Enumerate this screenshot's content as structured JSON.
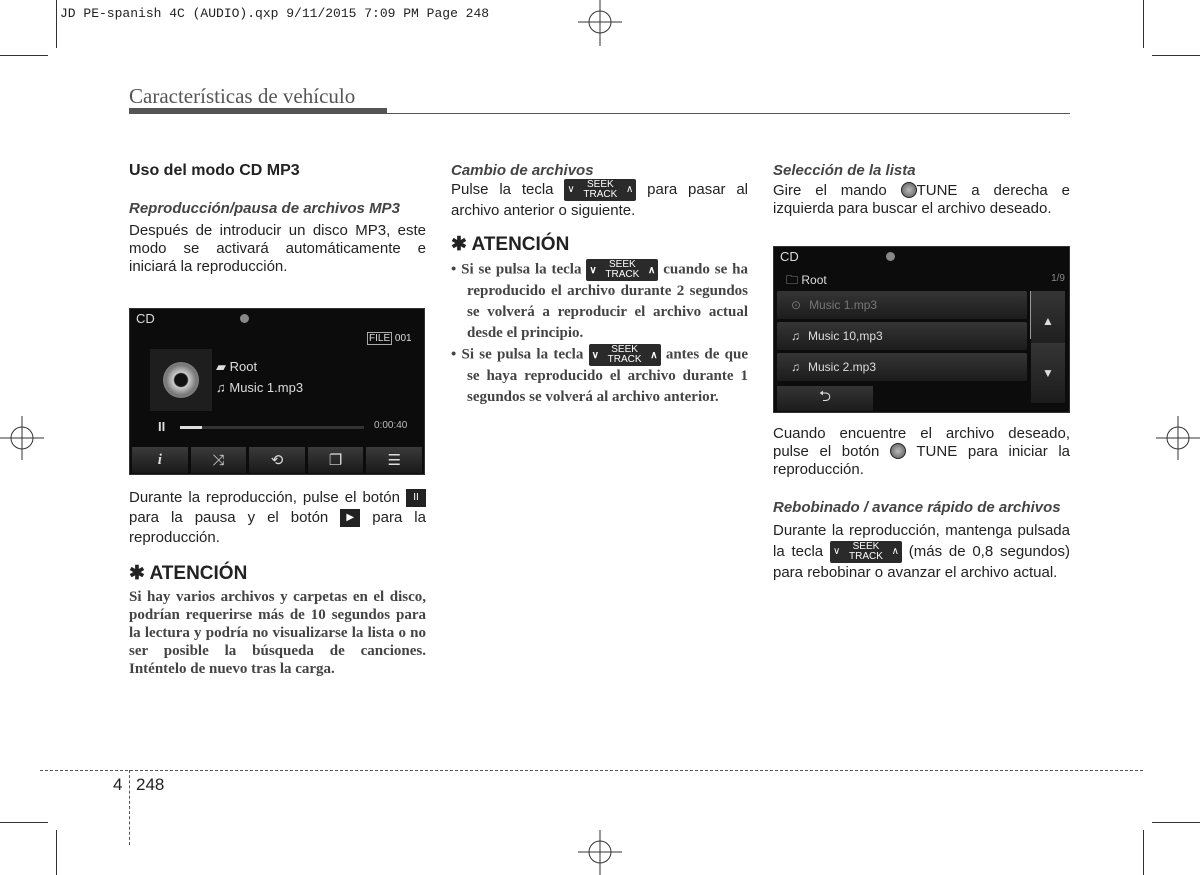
{
  "slug": "JD PE-spanish 4C (AUDIO).qxp  9/11/2015  7:09 PM  Page 248",
  "header": {
    "title": "Características de vehículo"
  },
  "seek": {
    "top": "SEEK",
    "bottom": "TRACK"
  },
  "left": {
    "heading": "Uso del modo CD MP3",
    "sub1": "Reproducción/pausa de archivos MP3",
    "p1": "Después de introducir un disco MP3, este modo se activará automáticamente e iniciará la reproducción.",
    "screen": {
      "source": "CD",
      "file_label": "FILE",
      "file_num": "001",
      "folder": "Root",
      "track": "Music 1.mp3",
      "time": "0:00:40",
      "progress": 0.12
    },
    "p2a": "Durante la reproducción, pulse el botón",
    "p2b": "para la pausa y el botón",
    "p2c": "para la reproducción.",
    "att_title": "✱ ATENCIÓN",
    "att_text": "Si hay varios archivos y carpetas en el disco, podrían requerirse más de 10 segundos para la lectura y podría no visualizarse la lista o no ser posible la búsqueda de canciones. Inténtelo de nuevo tras la carga."
  },
  "middle": {
    "sub1": "Cambio de archivos",
    "p1a": "Pulse la tecla",
    "p1b": "para pasar al archivo anterior o siguiente.",
    "att_title": "✱ ATENCIÓN",
    "b1a": "Si se pulsa la tecla",
    "b1b": "cuando se ha reproducido el archivo durante 2 segundos se volverá a reproducir el archivo actual desde el principio.",
    "b2a": "Si se pulsa la tecla",
    "b2b": "antes de que se haya reproducido el archivo durante 1 segundos se volverá al archivo anterior."
  },
  "right": {
    "sub1": "Selección de la lista",
    "p1a": "Gire el mando",
    "p1b": "TUNE a derecha e izquierda para buscar el archivo deseado.",
    "screen": {
      "source": "CD",
      "folder": "Root",
      "count": "1/9",
      "items": [
        "Music 1.mp3",
        "Music 10,mp3",
        "Music 2.mp3"
      ]
    },
    "p2a": "Cuando encuentre el archivo deseado, pulse el botón",
    "p2b": "TUNE para iniciar la reproducción.",
    "sub2": "Rebobinado / avance rápido de archivos",
    "p3a": "Durante la reproducción, mantenga pulsada la tecla",
    "p3b": "(más de 0,8 segundos) para rebobinar o avanzar el archivo actual."
  },
  "footer": {
    "chapter": "4",
    "page": "248"
  }
}
